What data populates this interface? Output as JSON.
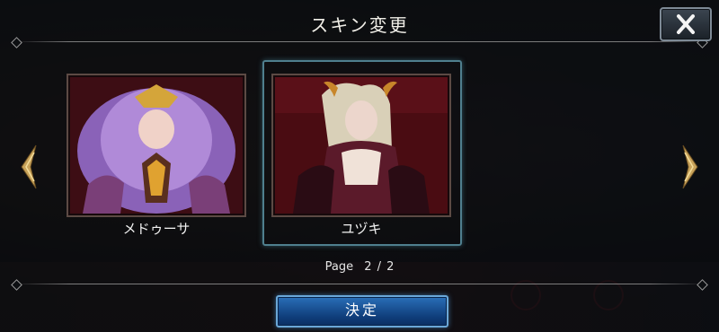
{
  "dialog": {
    "title": "スキン変更",
    "skins": [
      {
        "name": "メドゥーサ",
        "selected": false
      },
      {
        "name": "ユヅキ",
        "selected": true
      }
    ],
    "page_label": "Page",
    "page_value": "2 / 2",
    "confirm_label": "決定"
  },
  "icons": {
    "close": "close-x-icon",
    "prev": "arrow-left-icon",
    "next": "arrow-right-icon"
  },
  "colors": {
    "accent_blue": "#2a6fb8",
    "selection": "#4f7f8e",
    "arrow_gold": "#c9a35a"
  }
}
